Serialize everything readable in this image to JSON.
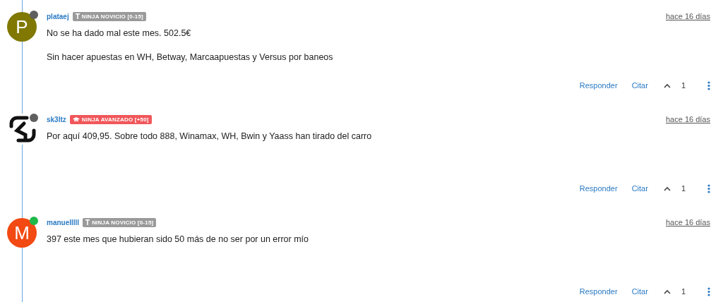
{
  "posts": [
    {
      "author": "plataej",
      "online": false,
      "avatar": {
        "kind": "letter",
        "letter": "P",
        "color": "#807800"
      },
      "badge": {
        "kind": "novice",
        "label": "NINJA NOVICIO [0-15]"
      },
      "time": "hace 16 días",
      "paragraphs": [
        "No se ha dado mal este mes. 502.5€",
        "Sin hacer apuestas en WH, Betway, Marcaapuestas y Versus por baneos"
      ],
      "actions": {
        "reply": "Responder",
        "quote": "Citar",
        "votes": "1"
      }
    },
    {
      "author": "sk3ltz",
      "online": false,
      "avatar": {
        "kind": "logo"
      },
      "badge": {
        "kind": "advanced",
        "label": "NINJA AVANZADO [+50]"
      },
      "time": "hace 16 días",
      "paragraphs": [
        "Por aquí 409,95. Sobre todo 888, Winamax, WH, Bwin y Yaass han tirado del carro"
      ],
      "actions": {
        "reply": "Responder",
        "quote": "Citar",
        "votes": "1"
      }
    },
    {
      "author": "manuelllll",
      "online": true,
      "avatar": {
        "kind": "letter",
        "letter": "M",
        "color": "#f24a12"
      },
      "badge": {
        "kind": "novice",
        "label": "NINJA NOVICIO [0-15]"
      },
      "time": "hace 16 días",
      "paragraphs": [
        "397 este mes que hubieran sido 50 más de no ser por un error mío"
      ],
      "actions": {
        "reply": "Responder",
        "quote": "Citar",
        "votes": "1"
      }
    }
  ]
}
